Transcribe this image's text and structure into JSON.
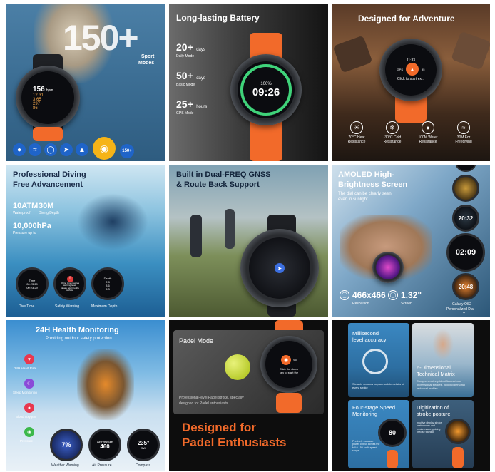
{
  "panel1": {
    "big_number": "150+",
    "caption_line1": "Sport",
    "caption_line2": "Modes",
    "watch_values": [
      "156",
      "12.31",
      "3.65",
      "297",
      "86"
    ],
    "watch_unit": "bpm",
    "badge": "150+",
    "sport_icons": [
      "walk-icon",
      "swim-icon",
      "cycle-icon",
      "run-icon",
      "hike-icon",
      "padel-icon"
    ]
  },
  "panel2": {
    "title": "Long-lasting Battery",
    "stats": [
      {
        "value": "20+",
        "unit": "days",
        "label": "Daily Mode"
      },
      {
        "value": "50+",
        "unit": "days",
        "label": "Basic Mode"
      },
      {
        "value": "25+",
        "unit": "hours",
        "label": "GPS Mode"
      }
    ],
    "watch_percent": "100%",
    "watch_time": "09:26",
    "battery_level": 1.0
  },
  "panel3": {
    "title": "Designed for Adventure",
    "watch_time": "11:33",
    "watch_gps": "GPS",
    "watch_value": "95",
    "watch_prompt": "Click to start ex...",
    "features": [
      {
        "icon": "heat-icon",
        "line1": "70°C Heat",
        "line2": "Resistance"
      },
      {
        "icon": "cold-icon",
        "line1": "-30°C Cold",
        "line2": "Resistance"
      },
      {
        "icon": "water-icon",
        "line1": "100M Water",
        "line2": "Resistance"
      },
      {
        "icon": "freediving-icon",
        "line1": "30M For",
        "line2": "Freediving"
      }
    ]
  },
  "panel4": {
    "title_line1": "Professional Diving",
    "title_line2": "Free Advancement",
    "stat1_value": "10ATM",
    "stat1_label": "Waterproof",
    "stat2_value": "30M",
    "stat2_label": "Diving Depth",
    "stat3_value": "10,000hPa",
    "stat3_label": "Pressure up to",
    "dial1_title": "Time",
    "dial1_values": [
      "00:23:29",
      "00:23:29"
    ],
    "dial2_text": "Diving time reaches warning level, please return to the surface",
    "dial3_title": "Depth",
    "dial3_values": [
      "2.8",
      "3.6",
      "6.3"
    ],
    "labels": [
      "Dive Time",
      "Safety Warning",
      "Maximum Depth"
    ]
  },
  "panel5": {
    "title_line1": "Built in Dual-FREQ GNSS",
    "title_line2": "& Route Back Support"
  },
  "panel6": {
    "title_line1": "AMOLED High-",
    "title_line2": "Brightness Screen",
    "subtitle_line1": "The dial can be clearly seen",
    "subtitle_line2": "even in sunlight",
    "resolution_value": "466x466",
    "resolution_label": "Resolution",
    "screen_value": "1,32\"",
    "screen_label": "Screen",
    "dial_times": [
      "20:32",
      "02:09",
      "20:48"
    ],
    "caption_line1": "Galaxy OS2",
    "caption_line2": "Personalized Dial"
  },
  "panel7": {
    "title": "24H Health Monitoring",
    "subtitle": "Providing outdoor safety protection",
    "items": [
      {
        "icon": "heart-icon",
        "label": "24H Heart Rate",
        "color": "#e8384f"
      },
      {
        "icon": "sleep-icon",
        "label": "Sleep Monitoring",
        "color": "#8a4bd8"
      },
      {
        "icon": "oxygen-icon",
        "label": "Blood Oxygen",
        "color": "#e8384f"
      },
      {
        "icon": "pressure-icon",
        "label": "Pressure",
        "color": "#3cb84a"
      }
    ],
    "dial1_value": "7%",
    "dial2_title": "Air Pressure",
    "dial2_value": "460",
    "dial3_value": "235°",
    "dial3_dir": "SW",
    "labels": [
      "Weather Warning",
      "Air Pressure",
      "Compass"
    ]
  },
  "panel8": {
    "card_title": "Padel Mode",
    "card_text_line1": "Professional-level Padel stroke, specially",
    "card_text_line2": "designed for Padel enthusiasts.",
    "watch_text_line1": "Click the down",
    "watch_text_line2": "key to start the",
    "watch_value": "95",
    "headline_line1": "Designed for",
    "headline_line2": "Padel Enthusiasts"
  },
  "panel9": {
    "cards": [
      {
        "title_line1": "Millisecond",
        "title_line2": "level accuracy",
        "text": "Six-axis sensors capture subtle details of every stroke"
      },
      {
        "title_line1": "6-Dimensional",
        "title_line2": "Technical Matrix",
        "text": "Comprehensively identifies various professional strokes, building personal technical profiles"
      },
      {
        "title_line1": "Four-stage Speed",
        "title_line2": "Monitoring",
        "text": "Precisely measure power output across the full 0-150 km/h speed range"
      },
      {
        "title_line1": "Digitization of",
        "title_line2": "stroke posture",
        "text": "Intuitive display stroke preferences and weaknesses, guiding precise training"
      }
    ],
    "speed_value": "80"
  },
  "colors": {
    "accent_orange": "#f26a2a",
    "accent_green": "#3fd37a"
  }
}
